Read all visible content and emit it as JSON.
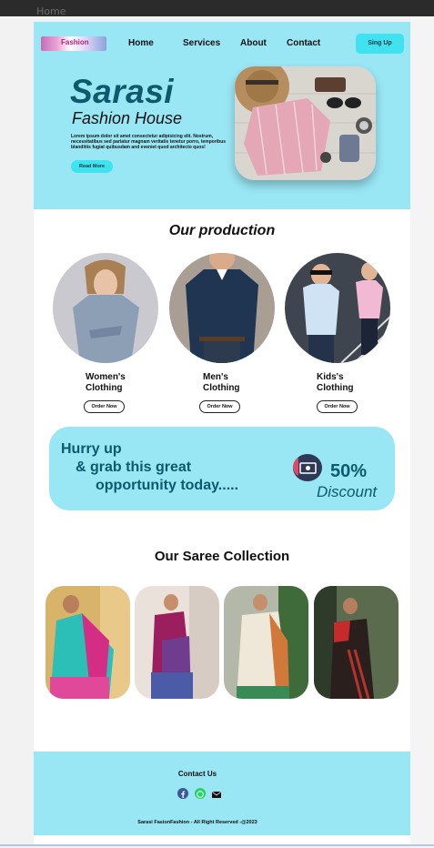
{
  "browser": {
    "tab_label": "Home"
  },
  "header": {
    "logo_text": "Fashion",
    "nav": [
      "Home",
      "Services",
      "About",
      "Contact"
    ],
    "signup_label": "Sing Up"
  },
  "hero": {
    "brand": "Sarasi",
    "tagline": "Fashion House",
    "body": "Lorem ipsum dolor sit amet consectetur adipisicing elit. Nostrum, necessitatibus sed pariatur magnam veritatis tenetur porro, temporibus blanditiis fugiat quibusdam and eveniet quod architecto quos!",
    "cta_label": "Read More"
  },
  "production": {
    "title": "Our production",
    "items": [
      {
        "label_line1": "Women's",
        "label_line2": "Clothing",
        "button": "Order Now"
      },
      {
        "label_line1": "Men's",
        "label_line2": "Clothing",
        "button": "Order Now"
      },
      {
        "label_line1": "Kids's",
        "label_line2": "Clothing",
        "button": "Order Now"
      }
    ]
  },
  "promo": {
    "line1": "Hurry up",
    "line2": "& grab this great",
    "line3": "opportunity today.....",
    "percent": "50%",
    "discount": "Discount",
    "icon": "money-icon"
  },
  "saree": {
    "title": "Our Saree Collection"
  },
  "footer": {
    "contact_label": "Contact Us",
    "icons": [
      "facebook-icon",
      "whatsapp-icon",
      "email-icon"
    ],
    "copyright": "Sarasi FasionFashion - All Right Reserved -@2023"
  },
  "colors": {
    "accent": "#99e6f5",
    "button": "#3fe2ee",
    "brand_text": "#0e5a6c"
  }
}
